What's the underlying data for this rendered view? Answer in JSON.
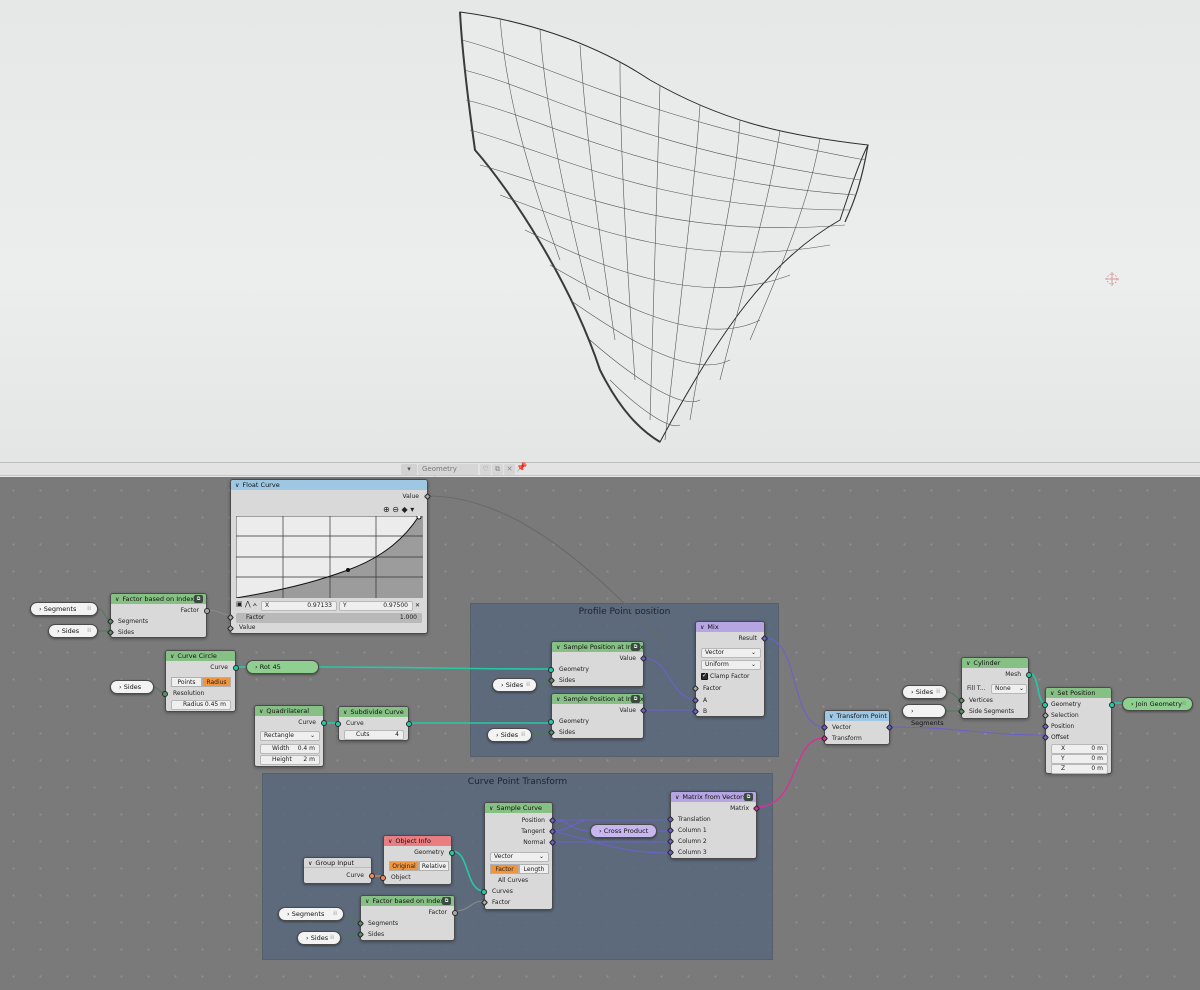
{
  "header": {
    "editor_icon": "node-editor-icon",
    "tree_name": "Geometry Nodes",
    "pin_icon": "pin-icon"
  },
  "frames": {
    "profile": "Profile Point position",
    "curve_transform": "Curve Point Transform"
  },
  "float_curve": {
    "title": "Float Curve",
    "out_value": "Value",
    "x_label": "X",
    "x_value": "0.97133",
    "y_label": "Y",
    "y_value": "0.97500",
    "factor_label": "Factor",
    "factor_value": "1.000",
    "in_value": "Value",
    "close": "✕"
  },
  "factor_index_top": {
    "title": "Factor based on Index",
    "out_factor": "Factor",
    "in_segments": "Segments",
    "in_sides": "Sides"
  },
  "pills": {
    "segments": "Segments",
    "sides": "Sides",
    "rot45": "Rot 45",
    "join_geometry": "Join Geometry",
    "cross_product": "Cross Product",
    "dots": "⁞⁞"
  },
  "curve_circle": {
    "title": "Curve Circle",
    "out_curve": "Curve",
    "mode_points": "Points",
    "mode_radius": "Radius",
    "resolution": "Resolution",
    "radius_label": "Radius",
    "radius_value": "0.45 m"
  },
  "quadrilateral": {
    "title": "Quadrilateral",
    "out_curve": "Curve",
    "shape": "Rectangle",
    "width_label": "Width",
    "width_value": "0.4 m",
    "height_label": "Height",
    "height_value": "2 m"
  },
  "subdivide": {
    "title": "Subdivide Curve",
    "in_curve": "Curve",
    "cuts_label": "Cuts",
    "cuts_value": "4"
  },
  "sample_pos_1": {
    "title": "Sample Position at Index",
    "out_value": "Value",
    "in_geometry": "Geometry",
    "in_sides": "Sides"
  },
  "sample_pos_2": {
    "title": "Sample Position at Index",
    "out_value": "Value",
    "in_geometry": "Geometry",
    "in_sides": "Sides"
  },
  "mix": {
    "title": "Mix",
    "out_result": "Result",
    "data_type": "Vector",
    "factor_mode": "Uniform",
    "clamp": "Clamp Factor",
    "in_factor": "Factor",
    "in_a": "A",
    "in_b": "B"
  },
  "transform_point": {
    "title": "Transform Point",
    "in_vector": "Vector",
    "in_transform": "Transform"
  },
  "cylinder": {
    "title": "Cylinder",
    "out_mesh": "Mesh",
    "fill_label": "Fill T...",
    "fill_value": "None",
    "in_vertices": "Vertices",
    "in_side_segments": "Side Segments"
  },
  "set_position": {
    "title": "Set Position",
    "in_geometry": "Geometry",
    "in_selection": "Selection",
    "in_position": "Position",
    "in_offset": "Offset",
    "x_label": "X",
    "x_value": "0 m",
    "y_label": "Y",
    "y_value": "0 m",
    "z_label": "Z",
    "z_value": "0 m"
  },
  "group_input": {
    "title": "Group Input",
    "out_curve": "Curve"
  },
  "object_info": {
    "title": "Object Info",
    "out_geometry": "Geometry",
    "mode_original": "Original",
    "mode_relative": "Relative",
    "in_object": "Object"
  },
  "factor_index_bottom": {
    "title": "Factor based on Index",
    "out_factor": "Factor",
    "in_segments": "Segments",
    "in_sides": "Sides"
  },
  "sample_curve": {
    "title": "Sample Curve",
    "out_position": "Position",
    "out_tangent": "Tangent",
    "out_normal": "Normal",
    "data_type": "Vector",
    "mode_factor": "Factor",
    "mode_length": "Length",
    "all_curves": "All Curves",
    "in_curves": "Curves",
    "in_factor": "Factor"
  },
  "matrix_vectors": {
    "title": "Matrix from Vectors",
    "out_matrix": "Matrix",
    "in_translation": "Translation",
    "in_col1": "Column 1",
    "in_col2": "Column 2",
    "in_col3": "Column 3"
  },
  "colors": {
    "geometry_socket": "#27c9a3",
    "vector_socket": "#6c61c9",
    "matrix_socket": "#d4349a",
    "radius_active": "#f0953c"
  }
}
